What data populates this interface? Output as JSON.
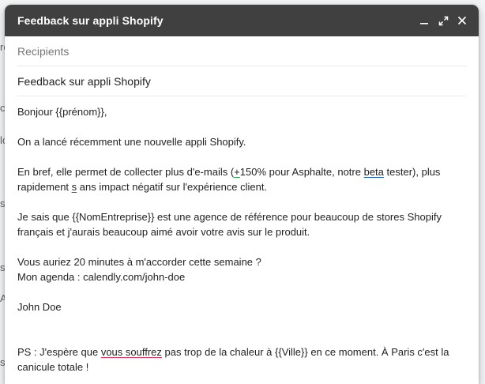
{
  "window": {
    "title": "Feedback sur appli Shopify",
    "controls": {
      "minimize_icon": "minimize-icon",
      "expand_icon": "expand-icon",
      "close_icon": "close-icon"
    }
  },
  "fields": {
    "recipients_placeholder": "Recipients",
    "subject_value": "Feedback sur appli Shopify"
  },
  "body": {
    "greeting": "Bonjour {{prénom}},",
    "p1": "On a lancé récemment une nouvelle appli Shopify.",
    "p2": {
      "a": "En bref, elle permet de collecter plus d'e-mails (",
      "b": "+",
      "c": "150% pour Asphalte, notre ",
      "d": "beta",
      "e": " tester), plus rapidement ",
      "f": "s",
      "g": " ",
      "h": "ans impact négatif sur l'expérience client."
    },
    "p3": "Je sais que {{NomEntreprise}} est une agence de référence pour beaucoup de stores Shopify français et j'aurais beaucoup aimé avoir votre avis sur le produit.",
    "p4_line1": "Vous auriez 20 minutes à m'accorder cette semaine ?",
    "p4_line2": "Mon agenda : calendly.com/john-doe",
    "signature": "John Doe",
    "ps": {
      "a": "PS : J'espère que ",
      "b": "vous souffrez",
      "c": " pas trop de la chaleur à {{Ville}} en ce moment. À Paris c'est la canicule totale !"
    }
  },
  "background_fragments": [
    "re",
    "c",
    "lo",
    "s",
    "sa",
    "A",
    "su"
  ],
  "colors": {
    "titlebar": "#404040",
    "spell_underline_blue": "#1a5fb4",
    "spell_underline_green": "#2e9e4f",
    "spell_underline_red": "#d93a5b"
  }
}
